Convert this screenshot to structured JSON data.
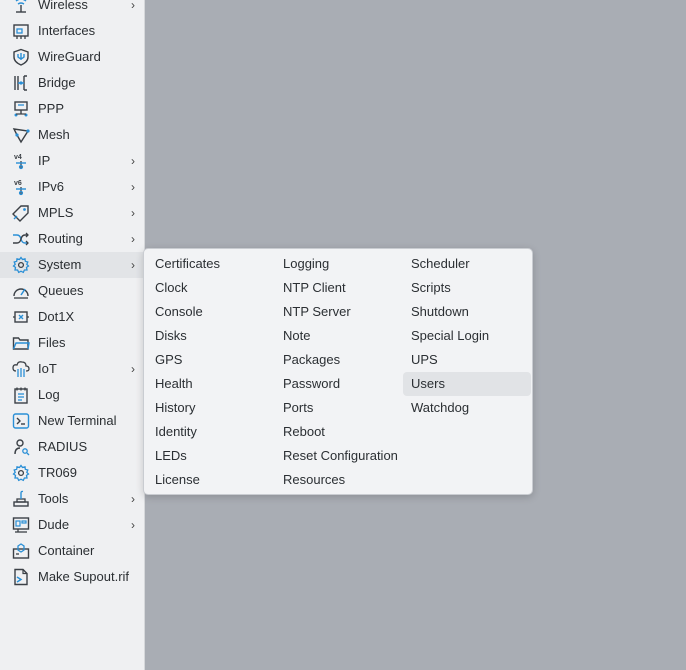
{
  "sidebar": {
    "items": [
      {
        "label": "Wireless",
        "icon": "wireless-icon",
        "has_submenu": true
      },
      {
        "label": "Interfaces",
        "icon": "interfaces-icon",
        "has_submenu": false
      },
      {
        "label": "WireGuard",
        "icon": "wireguard-icon",
        "has_submenu": false
      },
      {
        "label": "Bridge",
        "icon": "bridge-icon",
        "has_submenu": false
      },
      {
        "label": "PPP",
        "icon": "ppp-icon",
        "has_submenu": false
      },
      {
        "label": "Mesh",
        "icon": "mesh-icon",
        "has_submenu": false
      },
      {
        "label": "IP",
        "icon": "ipv4-icon",
        "has_submenu": true
      },
      {
        "label": "IPv6",
        "icon": "ipv6-icon",
        "has_submenu": true
      },
      {
        "label": "MPLS",
        "icon": "mpls-tag-icon",
        "has_submenu": true
      },
      {
        "label": "Routing",
        "icon": "routing-icon",
        "has_submenu": true
      },
      {
        "label": "System",
        "icon": "system-gear-icon",
        "has_submenu": true,
        "active": true
      },
      {
        "label": "Queues",
        "icon": "queues-gauge-icon",
        "has_submenu": false
      },
      {
        "label": "Dot1X",
        "icon": "dot1x-icon",
        "has_submenu": false
      },
      {
        "label": "Files",
        "icon": "folder-icon",
        "has_submenu": false
      },
      {
        "label": "IoT",
        "icon": "iot-icon",
        "has_submenu": true
      },
      {
        "label": "Log",
        "icon": "log-icon",
        "has_submenu": false
      },
      {
        "label": "New Terminal",
        "icon": "terminal-icon",
        "has_submenu": false
      },
      {
        "label": "RADIUS",
        "icon": "radius-icon",
        "has_submenu": false
      },
      {
        "label": "TR069",
        "icon": "tr069-gear-icon",
        "has_submenu": false
      },
      {
        "label": "Tools",
        "icon": "tools-icon",
        "has_submenu": true
      },
      {
        "label": "Dude",
        "icon": "dude-icon",
        "has_submenu": true
      },
      {
        "label": "Container",
        "icon": "container-icon",
        "has_submenu": false
      },
      {
        "label": "Make Supout.rif",
        "icon": "supout-file-icon",
        "has_submenu": false
      }
    ],
    "chevron": "›"
  },
  "submenu": {
    "columns": [
      [
        "Certificates",
        "Clock",
        "Console",
        "Disks",
        "GPS",
        "Health",
        "History",
        "Identity",
        "LEDs",
        "License"
      ],
      [
        "Logging",
        "NTP Client",
        "NTP Server",
        "Note",
        "Packages",
        "Password",
        "Ports",
        "Reboot",
        "Reset Configuration",
        "Resources"
      ],
      [
        "Scheduler",
        "Scripts",
        "Shutdown",
        "Special Login",
        "UPS",
        "Users",
        "Watchdog"
      ]
    ],
    "highlighted": "Users"
  },
  "colors": {
    "icon_blue": "#2a8fd6",
    "icon_dark": "#3b4046",
    "background": "#a9adb4",
    "sidebar_bg": "#eff0f2",
    "menu_bg": "#f2f3f5"
  }
}
